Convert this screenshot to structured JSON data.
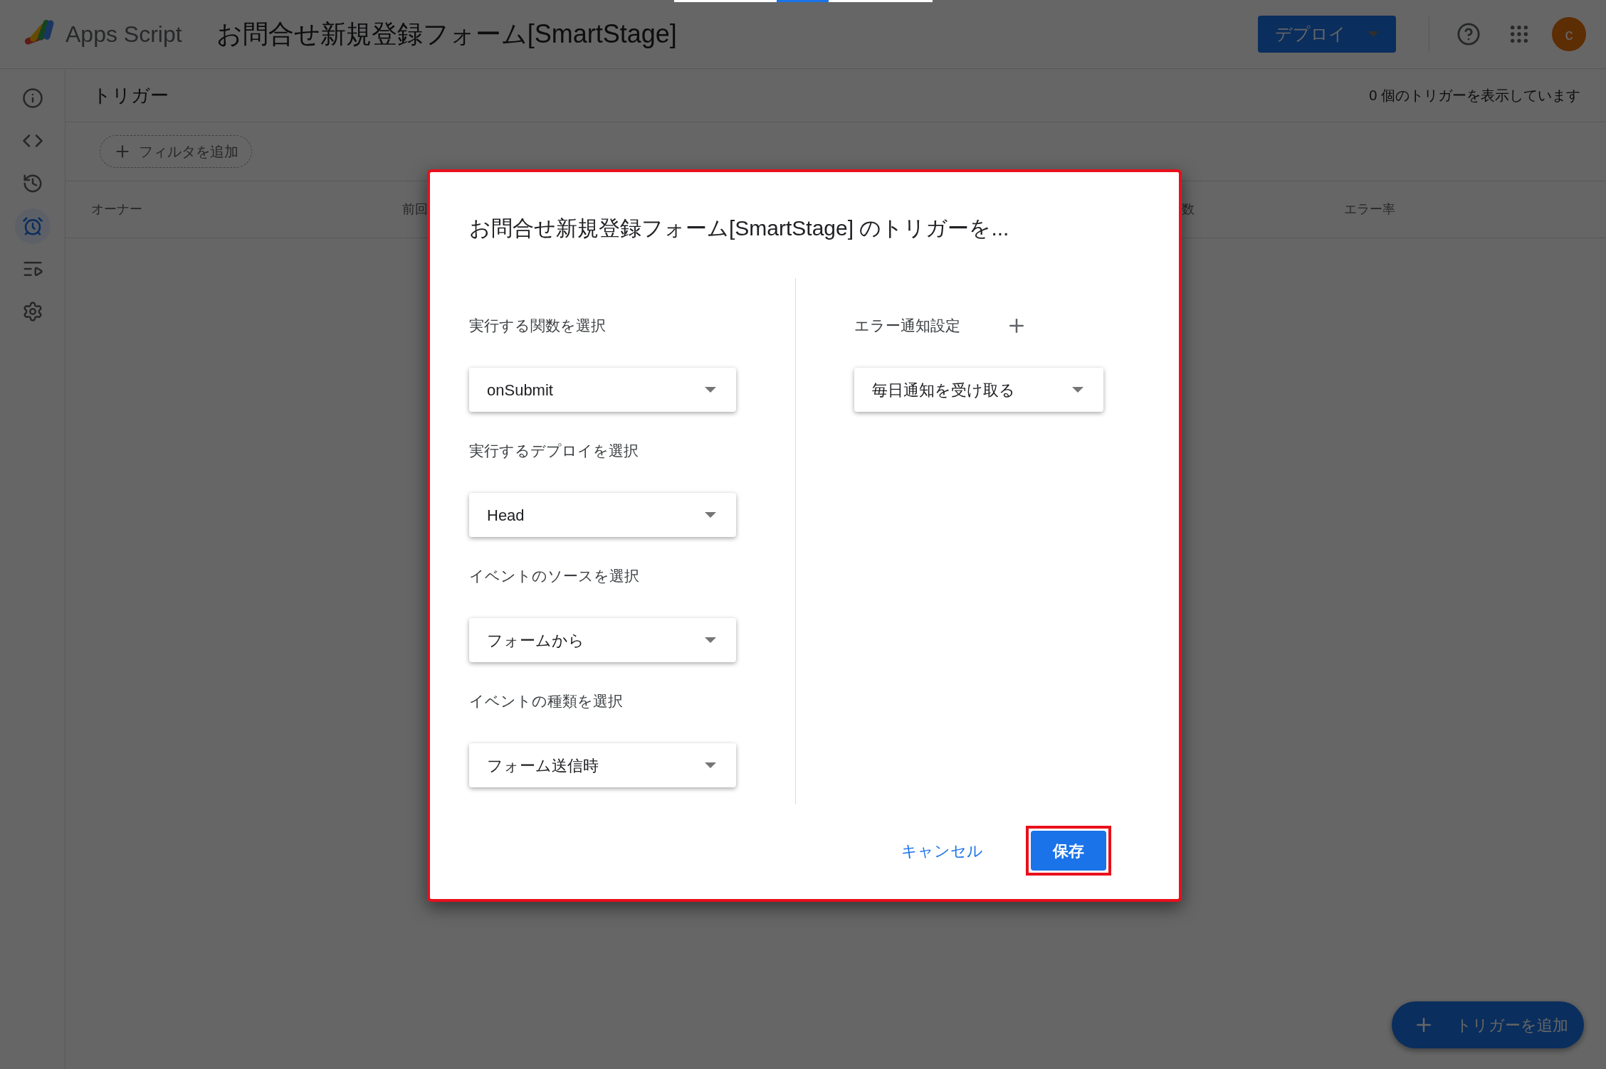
{
  "app": {
    "name": "Apps Script",
    "project_title": "お問合せ新規登録フォーム[SmartStage]"
  },
  "header_actions": {
    "deploy_button": "デプロイ",
    "avatar_initial": "c"
  },
  "sidebar": {
    "items": [
      {
        "kind": "info",
        "selected": false
      },
      {
        "kind": "code",
        "selected": false
      },
      {
        "kind": "history",
        "selected": false
      },
      {
        "kind": "triggers",
        "selected": true
      },
      {
        "kind": "executions",
        "selected": false
      },
      {
        "kind": "settings",
        "selected": false
      }
    ]
  },
  "page": {
    "title": "トリガー",
    "count_text": "0 個のトリガーを表示しています",
    "filter_chip": "フィルタを追加",
    "columns": [
      "オーナー",
      "前回",
      "数",
      "エラー率"
    ]
  },
  "dialog": {
    "title": "お問合せ新規登録フォーム[SmartStage] のトリガーを...",
    "outlined": true,
    "fields": [
      {
        "label": "実行する関数を選択",
        "value": "onSubmit"
      },
      {
        "label": "実行するデプロイを選択",
        "value": "Head"
      },
      {
        "label": "イベントのソースを選択",
        "value": "フォームから"
      },
      {
        "label": "イベントの種類を選択",
        "value": "フォーム送信時"
      }
    ],
    "error_notification": {
      "label": "エラー通知設定",
      "value": "毎日通知を受け取る"
    },
    "cancel_button": "キャンセル",
    "save_button": {
      "label": "保存",
      "outlined": true
    }
  },
  "fab": "トリガーを追加"
}
